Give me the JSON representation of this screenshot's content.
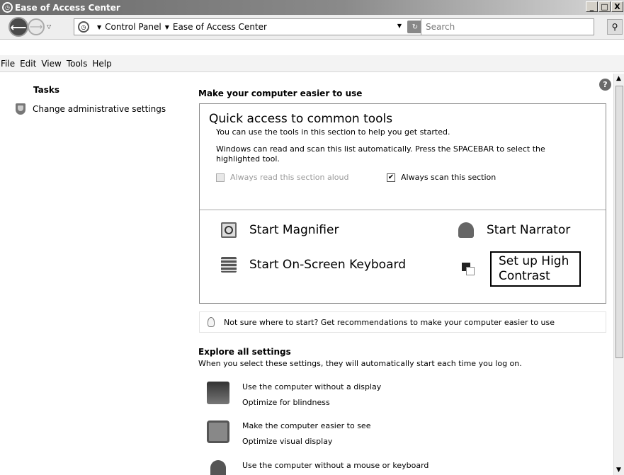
{
  "window": {
    "title": "Ease of Access Center",
    "controls": [
      "_",
      "□",
      "X"
    ]
  },
  "address": {
    "crumbs": [
      "Control Panel",
      "Ease of Access Center"
    ],
    "search_placeholder": "Search"
  },
  "menu": [
    "File",
    "Edit",
    "View",
    "Tools",
    "Help"
  ],
  "left_pane": {
    "tasks_title": "Tasks",
    "task_link": "Change administrative settings"
  },
  "main": {
    "heading": "Make your computer easier to use",
    "quick_access": {
      "title": "Quick access to common tools",
      "subtitle": "You can use the tools in this section to help you get started.",
      "description": "Windows can read and scan this list automatically.  Press the SPACEBAR to select the highlighted tool.",
      "read_aloud_label": "Always read this section aloud",
      "read_aloud_checked": false,
      "scan_label": "Always scan this section",
      "scan_checked": true,
      "tools": {
        "magnifier": "Start Magnifier",
        "narrator": "Start Narrator",
        "keyboard": "Start On-Screen Keyboard",
        "high_contrast": "Set up High Contrast"
      }
    },
    "tip": "Not sure where to start? Get recommendations to make your computer easier to use",
    "explore": {
      "title": "Explore all settings",
      "subtitle": "When you select these settings, they will automatically start each time you log on.",
      "settings": [
        {
          "title": "Use the computer without a display",
          "desc": "Optimize for blindness"
        },
        {
          "title": "Make the computer easier to see",
          "desc": "Optimize visual display"
        },
        {
          "title": "Use the computer without a mouse or keyboard",
          "desc": ""
        }
      ]
    }
  },
  "icons": {
    "help": "?",
    "check": "✔"
  }
}
